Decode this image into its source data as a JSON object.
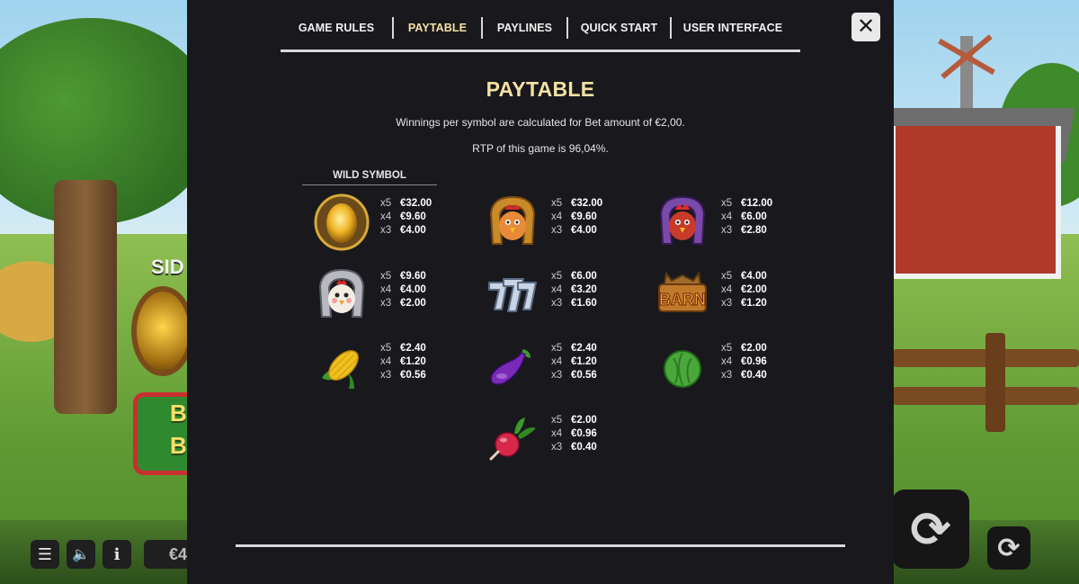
{
  "tabs": [
    {
      "label": "GAME RULES",
      "active": false
    },
    {
      "label": "PAYTABLE",
      "active": true
    },
    {
      "label": "PAYLINES",
      "active": false
    },
    {
      "label": "QUICK START",
      "active": false
    },
    {
      "label": "USER INTERFACE",
      "active": false
    }
  ],
  "close_icon": "✕",
  "paytable": {
    "title": "PAYTABLE",
    "bet_info": "Winnings per symbol are calculated for Bet amount of €2,00.",
    "rtp_info": "RTP of this game is 96,04%.",
    "wild_label": "WILD SYMBOL"
  },
  "symbols": [
    {
      "icon": "golden-egg-icon",
      "pays": [
        {
          "mult": "x5",
          "value": "€32.00"
        },
        {
          "mult": "x4",
          "value": "€9.60"
        },
        {
          "mult": "x3",
          "value": "€4.00"
        }
      ]
    },
    {
      "icon": "rooster-gold-horseshoe-icon",
      "pays": [
        {
          "mult": "x5",
          "value": "€32.00"
        },
        {
          "mult": "x4",
          "value": "€9.60"
        },
        {
          "mult": "x3",
          "value": "€4.00"
        }
      ]
    },
    {
      "icon": "rooster-purple-horseshoe-icon",
      "pays": [
        {
          "mult": "x5",
          "value": "€12.00"
        },
        {
          "mult": "x4",
          "value": "€6.00"
        },
        {
          "mult": "x3",
          "value": "€2.80"
        }
      ]
    },
    {
      "icon": "hen-horseshoe-icon",
      "pays": [
        {
          "mult": "x5",
          "value": "€9.60"
        },
        {
          "mult": "x4",
          "value": "€4.00"
        },
        {
          "mult": "x3",
          "value": "€2.00"
        }
      ]
    },
    {
      "icon": "lucky-sevens-icon",
      "pays": [
        {
          "mult": "x5",
          "value": "€6.00"
        },
        {
          "mult": "x4",
          "value": "€3.20"
        },
        {
          "mult": "x3",
          "value": "€1.60"
        }
      ]
    },
    {
      "icon": "barn-sign-icon",
      "label": "BARN",
      "pays": [
        {
          "mult": "x5",
          "value": "€4.00"
        },
        {
          "mult": "x4",
          "value": "€2.00"
        },
        {
          "mult": "x3",
          "value": "€1.20"
        }
      ]
    },
    {
      "icon": "corn-icon",
      "pays": [
        {
          "mult": "x5",
          "value": "€2.40"
        },
        {
          "mult": "x4",
          "value": "€1.20"
        },
        {
          "mult": "x3",
          "value": "€0.56"
        }
      ]
    },
    {
      "icon": "eggplant-icon",
      "pays": [
        {
          "mult": "x5",
          "value": "€2.40"
        },
        {
          "mult": "x4",
          "value": "€1.20"
        },
        {
          "mult": "x3",
          "value": "€0.56"
        }
      ]
    },
    {
      "icon": "cabbage-icon",
      "pays": [
        {
          "mult": "x5",
          "value": "€2.00"
        },
        {
          "mult": "x4",
          "value": "€0.96"
        },
        {
          "mult": "x3",
          "value": "€0.40"
        }
      ]
    },
    {
      "icon": "radish-icon",
      "pays": [
        {
          "mult": "x5",
          "value": "€2.00"
        },
        {
          "mult": "x4",
          "value": "€0.96"
        },
        {
          "mult": "x3",
          "value": "€0.40"
        }
      ]
    }
  ],
  "background": {
    "side_label": "SID",
    "bonus_lines": [
      "B",
      "BO"
    ],
    "bet_fragment": "€4"
  },
  "controls": {
    "menu_icon": "☰",
    "sound_icon": "🔈",
    "info_icon": "i",
    "spin_icon": "⟳",
    "autoplay_icon": "⟳"
  },
  "colors": {
    "accent": "#f3e1a4",
    "panel": "#19191d",
    "close_button": "#e9e9e9"
  }
}
